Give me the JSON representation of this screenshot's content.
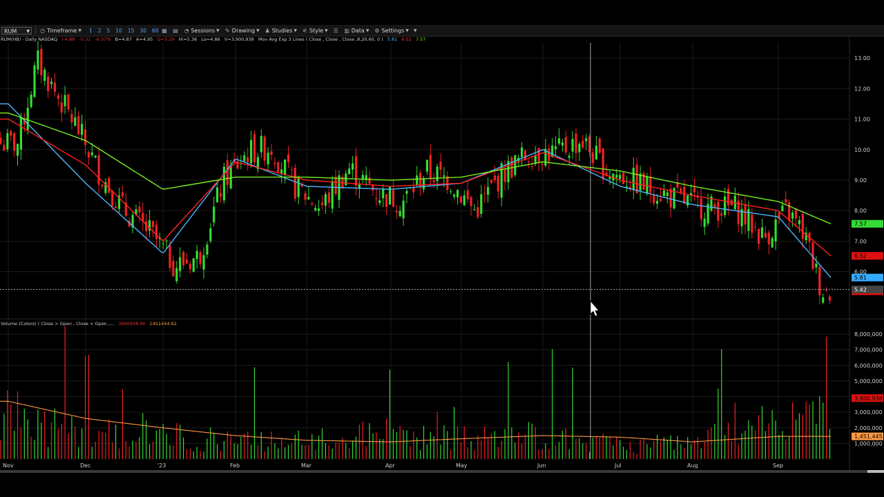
{
  "toolbar": {
    "symbol": "RUM",
    "timeframe_label": "Timeframe",
    "timeframes": [
      "1",
      "2",
      "5",
      "10",
      "15",
      "30",
      "60"
    ],
    "sessions_label": "Sessions",
    "drawing_label": "Drawing",
    "studies_label": "Studies",
    "style_label": "Style",
    "data_label": "Data",
    "settings_label": "Settings"
  },
  "info": {
    "title": "RUM(HB) - Daily  NASDAQ",
    "change": "(-4.88",
    "change2": "-0.31",
    "change_pct": "-6.07%",
    "bid": "B=4.87",
    "ask": "A=4.95",
    "open": "O=5.29",
    "high": "Hi=5.36",
    "low": "Lo=4.86",
    "volume": "V=3,900,938",
    "study": "Mov Avg Exp 3 Lines ( Close , Close , Close ,8,20,60, 0 )",
    "ma8": "5.81",
    "ma20": "6.52",
    "ma60": "7.57"
  },
  "volume_info": {
    "label": "Volume (Colors) ( Close > Open , Close < Open ,...",
    "value": "3900938.00",
    "avg": "1451444.62"
  },
  "colors": {
    "up": "#33dd33",
    "down": "#ee2222",
    "ma8": "#4cb8ff",
    "ma20": "#ff2222",
    "ma60": "#77ee22",
    "vol_avg": "#ff9944",
    "grid": "#1d1d1d",
    "crosshair": "#cccccc"
  },
  "chart_data": [
    {
      "type": "candlestick",
      "title": "RUM(HB) - Daily NASDAQ",
      "x_tick_labels": [
        "Nov",
        "Dec",
        "'23",
        "Feb",
        "Mar",
        "Apr",
        "May",
        "Jun",
        "Jul",
        "Aug",
        "Sep"
      ],
      "y_tick_labels": [
        "13.00",
        "12.00",
        "11.00",
        "10.00",
        "9.00",
        "8.00",
        "7.00",
        "6.00"
      ],
      "ylim": [
        4.5,
        13.5
      ],
      "grid": true,
      "crosshair_price": "5.42",
      "price_labels": {
        "ma60": "7.57",
        "ma20": "6.52",
        "ma8": "5.81",
        "last": "5.36"
      },
      "series": [
        {
          "name": "Close",
          "points": [
            [
              "Nov",
              10.2
            ],
            [
              "Nov",
              12.9
            ],
            [
              "Nov",
              11.8
            ],
            [
              "Nov",
              10.8
            ],
            [
              "Dec",
              9.3
            ],
            [
              "Dec",
              8.0
            ],
            [
              "Dec",
              7.3
            ],
            [
              "'23",
              6.2
            ],
            [
              "'23",
              6.5
            ],
            [
              "'23",
              9.0
            ],
            [
              "Feb",
              9.9
            ],
            [
              "Feb",
              10.1
            ],
            [
              "Feb",
              8.8
            ],
            [
              "Mar",
              8.1
            ],
            [
              "Mar",
              9.4
            ],
            [
              "Mar",
              8.6
            ],
            [
              "Apr",
              8.3
            ],
            [
              "Apr",
              9.3
            ],
            [
              "Apr",
              9.0
            ],
            [
              "May",
              8.0
            ],
            [
              "May",
              9.2
            ],
            [
              "May",
              9.9
            ],
            [
              "Jun",
              9.9
            ],
            [
              "Jun",
              10.3
            ],
            [
              "Jun",
              9.3
            ],
            [
              "Jul",
              8.9
            ],
            [
              "Jul",
              8.4
            ],
            [
              "Aug",
              8.1
            ],
            [
              "Aug",
              8.1
            ],
            [
              "Aug",
              7.1
            ],
            [
              "Sep",
              8.0
            ],
            [
              "Sep",
              7.2
            ],
            [
              "Sep",
              5.36
            ]
          ]
        },
        {
          "name": "Mov Avg Exp 8",
          "points": [
            [
              "Nov",
              11.5
            ],
            [
              "Dec",
              8.9
            ],
            [
              "'23",
              6.6
            ],
            [
              "Feb",
              9.7
            ],
            [
              "Mar",
              8.8
            ],
            [
              "Apr",
              8.7
            ],
            [
              "May",
              8.9
            ],
            [
              "Jun",
              10.0
            ],
            [
              "Jul",
              8.8
            ],
            [
              "Aug",
              8.2
            ],
            [
              "Sep",
              7.8
            ],
            [
              "Sep",
              5.81
            ]
          ]
        },
        {
          "name": "Mov Avg Exp 20",
          "points": [
            [
              "Nov",
              11.0
            ],
            [
              "Dec",
              9.5
            ],
            [
              "'23",
              7.0
            ],
            [
              "Feb",
              9.6
            ],
            [
              "Mar",
              9.0
            ],
            [
              "Apr",
              8.8
            ],
            [
              "May",
              8.9
            ],
            [
              "Jun",
              9.9
            ],
            [
              "Jul",
              9.0
            ],
            [
              "Aug",
              8.5
            ],
            [
              "Sep",
              8.0
            ],
            [
              "Sep",
              6.52
            ]
          ]
        },
        {
          "name": "Mov Avg Exp 60",
          "points": [
            [
              "Nov",
              11.2
            ],
            [
              "Dec",
              10.3
            ],
            [
              "'23",
              8.7
            ],
            [
              "Feb",
              9.1
            ],
            [
              "Mar",
              9.1
            ],
            [
              "Apr",
              9.0
            ],
            [
              "May",
              9.1
            ],
            [
              "Jun",
              9.6
            ],
            [
              "Jul",
              9.3
            ],
            [
              "Aug",
              8.8
            ],
            [
              "Sep",
              8.3
            ],
            [
              "Sep",
              7.57
            ]
          ]
        }
      ]
    },
    {
      "type": "bar",
      "title": "Volume (Colors)",
      "y_tick_labels": [
        "8,000,000",
        "7,000,000",
        "6,000,000",
        "5,000,000",
        "4,000,000",
        "3,000,000",
        "2,000,000",
        "1,000,000"
      ],
      "ylim": [
        0,
        8400000
      ],
      "price_labels": {
        "last": "3,900,938",
        "avg": "1,451,445"
      },
      "series": [
        {
          "name": "Volume",
          "values_by_month": {
            "Nov": 2800000,
            "Dec": 1600000,
            "'23": 1500000,
            "Feb": 1200000,
            "Mar": 1100000,
            "Apr": 1700000,
            "May": 1300000,
            "Jun": 1500000,
            "Jul": 900000,
            "Aug": 1000000,
            "Sep": 2600000
          }
        },
        {
          "name": "Volume Avg",
          "values_by_month": {
            "Nov": 3700000,
            "Dec": 2600000,
            "'23": 2000000,
            "Feb": 1500000,
            "Mar": 1200000,
            "Apr": 1100000,
            "May": 1300000,
            "Jun": 1500000,
            "Jul": 1400000,
            "Aug": 1100000,
            "Sep": 1451445
          }
        }
      ]
    }
  ]
}
